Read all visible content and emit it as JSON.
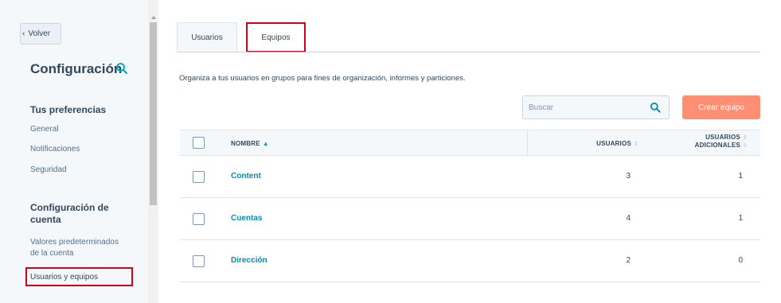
{
  "sidebar": {
    "back_label": "Volver",
    "title": "Configuración",
    "sections": [
      {
        "heading": "Tus preferencias",
        "items": [
          "General",
          "Notificaciones",
          "Seguridad"
        ]
      },
      {
        "heading_line1": "Configuración de",
        "heading_line2": "cuenta",
        "items": [
          "Valores predeterminados",
          "de la cuenta",
          "Usuarios y equipos"
        ]
      }
    ]
  },
  "tabs": [
    {
      "label": "Usuarios"
    },
    {
      "label": "Equipos"
    }
  ],
  "description": "Organiza a tus usuarios en grupos para fines de organización, informes y particiones.",
  "search": {
    "placeholder": "Buscar"
  },
  "create_button": "Crear equipo",
  "table": {
    "headers": {
      "name": "NOMBRE",
      "users": "USUARIOS",
      "extra_line1": "USUARIOS",
      "extra_line2": "ADICIONALES"
    },
    "rows": [
      {
        "name": "Content",
        "users": "3",
        "extra": "1"
      },
      {
        "name": "Cuentas",
        "users": "4",
        "extra": "1"
      },
      {
        "name": "Dirección",
        "users": "2",
        "extra": "0"
      }
    ]
  },
  "colors": {
    "accent_orange": "#ff8f73",
    "link_teal": "#0091ae",
    "highlight_red": "#d0021b",
    "text_dark": "#33475b"
  }
}
